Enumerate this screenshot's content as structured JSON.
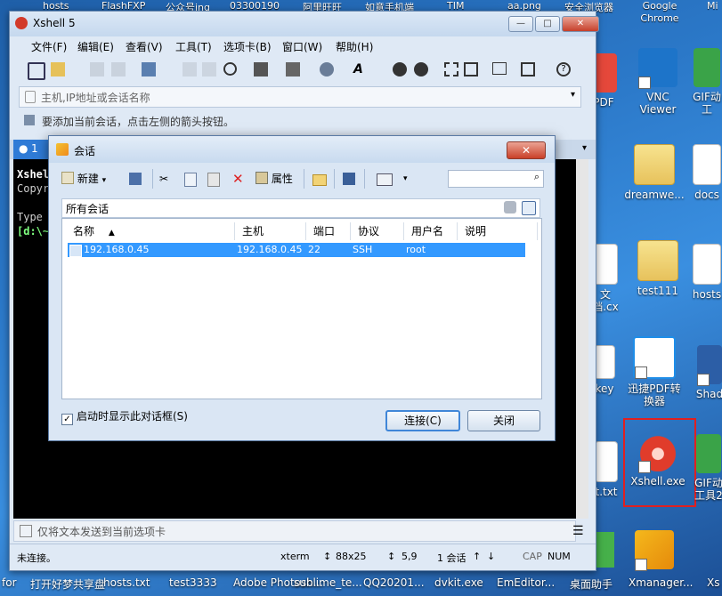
{
  "desktop": {
    "top_labels": [
      "hosts",
      "FlashFXP",
      "公众号ing",
      "03300190",
      "阿里旺旺",
      "如意手机端",
      "TIM",
      "aa.png",
      "安全浏览器",
      "Google Chrome",
      "Mi"
    ],
    "icons": [
      {
        "label": "PDF",
        "kind": "doc"
      },
      {
        "label": "VNC Viewer",
        "kind": "app"
      },
      {
        "label": "GIF动工",
        "kind": "app"
      },
      {
        "label": "dreamwe...",
        "kind": "folder"
      },
      {
        "label": "docs",
        "kind": "doc"
      },
      {
        "label": "文档.cx",
        "kind": "doc"
      },
      {
        "label": "test111",
        "kind": "folder"
      },
      {
        "label": "hosts",
        "kind": "doc"
      },
      {
        "label": "key",
        "kind": "doc"
      },
      {
        "label": "迅捷PDF转换器",
        "kind": "app"
      },
      {
        "label": "Shad",
        "kind": "app"
      },
      {
        "label": "t.txt",
        "kind": "doc"
      },
      {
        "label": "Xshell.exe",
        "kind": "app"
      },
      {
        "label": "GIF动工具2",
        "kind": "app"
      },
      {
        "label": "Xmanager...",
        "kind": "app"
      }
    ],
    "bottom_labels": [
      "for",
      "打开好梦共享盘",
      "hosts.txt",
      "test3333",
      "Adobe Photosh...",
      "sublime_te...",
      "QQ20201...",
      "dvkit.exe",
      "EmEditor...",
      "桌面助手",
      "Xmanager...",
      "Xs"
    ],
    "highlight_color": "#e02020"
  },
  "xshell": {
    "title": "Xshell 5",
    "window_buttons": [
      "—",
      "□",
      "✕"
    ],
    "menu": [
      "文件(F)",
      "编辑(E)",
      "查看(V)",
      "工具(T)",
      "选项卡(B)",
      "窗口(W)",
      "帮助(H)"
    ],
    "address_placeholder": "主机,IP地址或会话名称",
    "hint": "要添加当前会话，点击左侧的箭头按钮。",
    "tab_label": "1",
    "terminal_lines": [
      "Xshel",
      "Copyr",
      "",
      "Type",
      "[d:\\~"
    ],
    "send_bar": "仅将文本发送到当前选项卡",
    "status": {
      "left": "未连接。",
      "term": "xterm",
      "size": "88x25",
      "pos": "5,9",
      "sessions": "1 会话",
      "cap": "CAP",
      "num": "NUM"
    }
  },
  "dialog": {
    "title": "会话",
    "close_label": "✕",
    "toolbar": {
      "new_label": "新建",
      "properties_label": "属性"
    },
    "path": "所有会话",
    "columns": [
      "名称",
      "主机",
      "端口",
      "协议",
      "用户名",
      "说明"
    ],
    "rows": [
      {
        "name": "192.168.0.45",
        "host": "192.168.0.45",
        "port": "22",
        "protocol": "SSH",
        "user": "root",
        "note": ""
      }
    ],
    "startup_checkbox": "启动时显示此对话框(S)",
    "startup_checked": true,
    "connect_label": "连接(C)",
    "close_button_label": "关闭"
  }
}
